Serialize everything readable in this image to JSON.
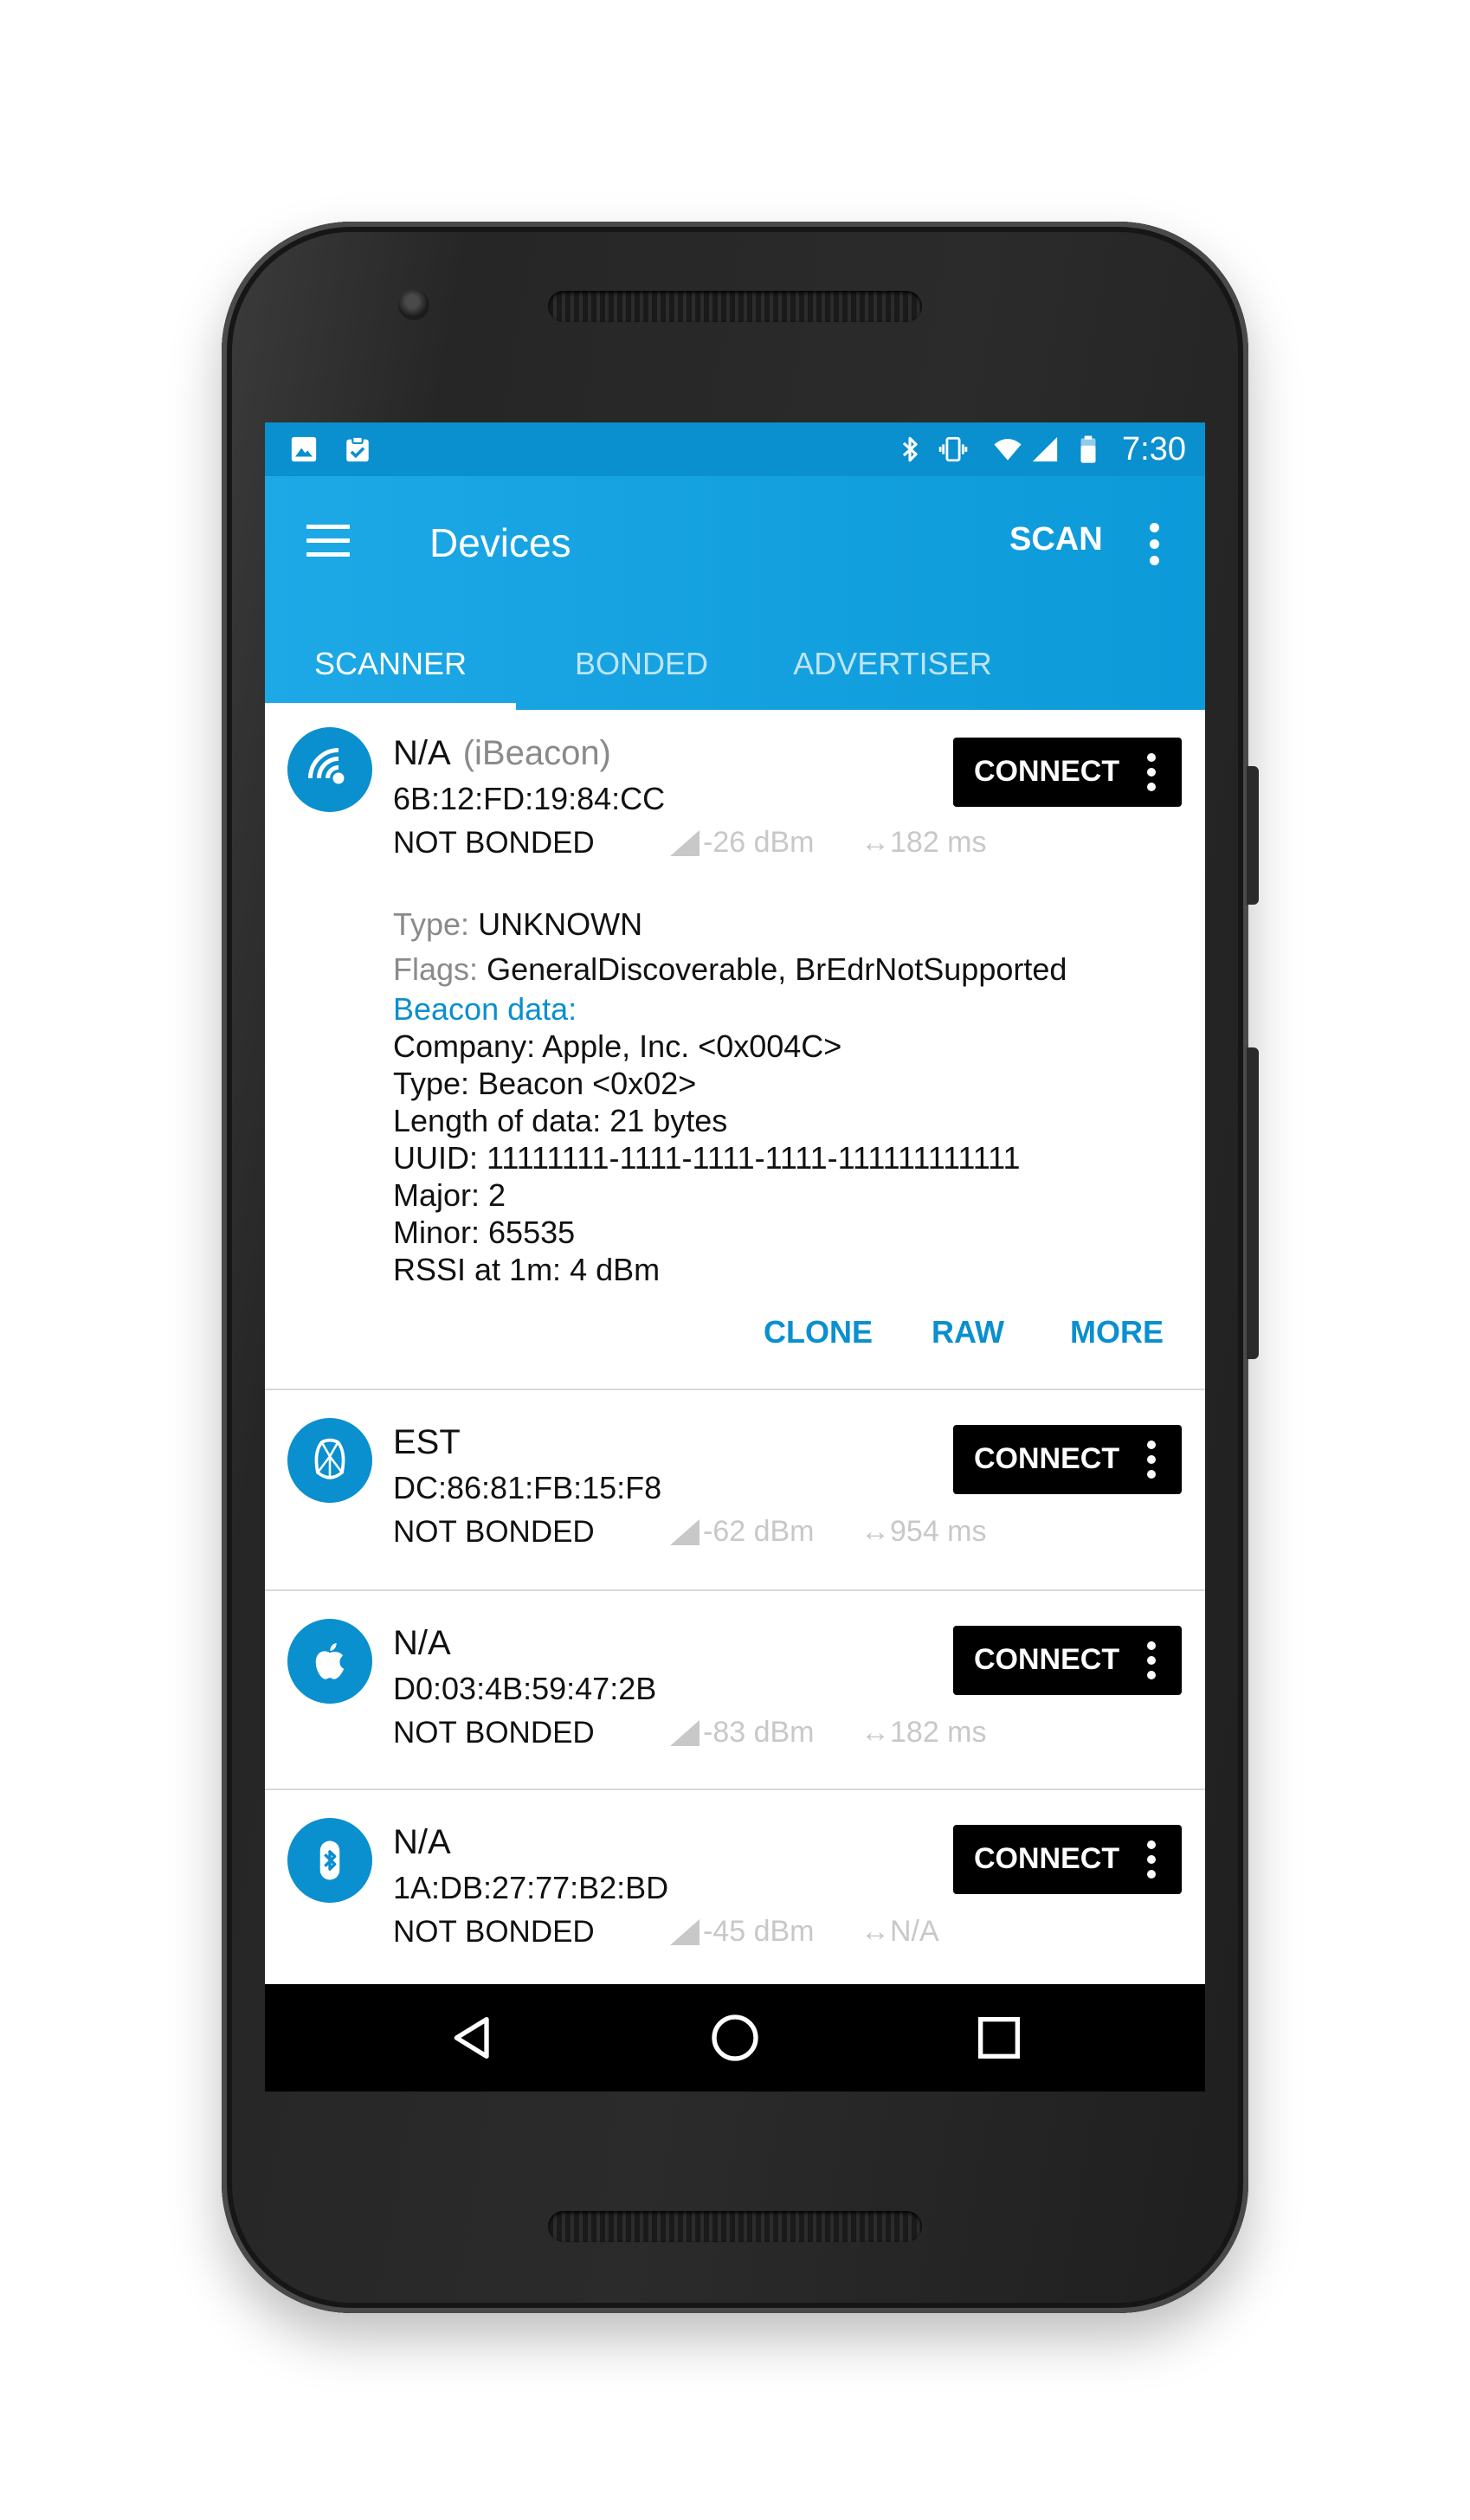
{
  "status_bar": {
    "time": "7:30",
    "left_icons": [
      "image-icon",
      "clipboard-check-icon"
    ],
    "right_icons": [
      "bluetooth-icon",
      "vibrate-icon",
      "wifi-icon",
      "cell-signal-icon",
      "battery-icon"
    ]
  },
  "app_bar": {
    "title": "Devices",
    "scan_label": "SCAN",
    "accent_color": "#0a8fcf"
  },
  "tabs": [
    {
      "label": "SCANNER",
      "active": true
    },
    {
      "label": "BONDED",
      "active": false
    },
    {
      "label": "ADVERTISER",
      "active": false
    }
  ],
  "devices": [
    {
      "name": "N/A",
      "type_tag": "(iBeacon)",
      "address": "6B:12:FD:19:84:CC",
      "bond": "NOT BONDED",
      "rssi": "-26 dBm",
      "interval": "↔182 ms",
      "icon": "beacon-icon",
      "connect_label": "CONNECT",
      "details": {
        "type_key": "Type:",
        "type_val": "UNKNOWN",
        "flags_key": "Flags:",
        "flags_val": "GeneralDiscoverable, BrEdrNotSupported",
        "beacon_header": "Beacon data:",
        "lines": [
          "Company: Apple, Inc. <0x004C>",
          "Type: Beacon <0x02>",
          "Length of data: 21 bytes",
          "UUID: 11111111-1111-1111-1111-111111111111",
          "Major: 2",
          "Minor: 65535",
          "RSSI at 1m: 4 dBm"
        ]
      },
      "actions": [
        "CLONE",
        "RAW",
        "MORE"
      ]
    },
    {
      "name": "EST",
      "address": "DC:86:81:FB:15:F8",
      "bond": "NOT BONDED",
      "rssi": "-62 dBm",
      "interval": "↔954 ms",
      "icon": "estimote-icon",
      "connect_label": "CONNECT"
    },
    {
      "name": "N/A",
      "address": "D0:03:4B:59:47:2B",
      "bond": "NOT BONDED",
      "rssi": "-83 dBm",
      "interval": "↔182 ms",
      "icon": "apple-icon",
      "connect_label": "CONNECT"
    },
    {
      "name": "N/A",
      "address": "1A:DB:27:77:B2:BD",
      "bond": "NOT BONDED",
      "rssi": "-45 dBm",
      "interval": "↔N/A",
      "icon": "bluetooth-icon",
      "connect_label": "CONNECT"
    }
  ],
  "nav": [
    "back-icon",
    "home-icon",
    "recents-icon"
  ]
}
